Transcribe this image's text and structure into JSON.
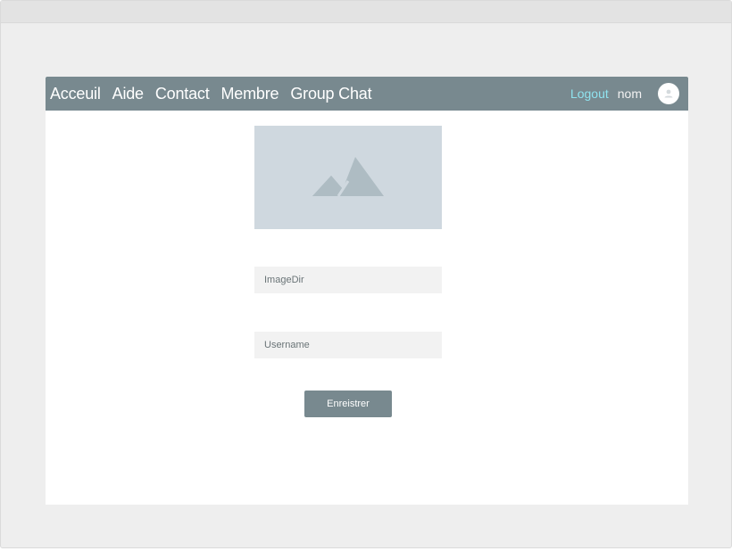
{
  "nav": {
    "links": [
      "Acceuil",
      "Aide",
      "Contact",
      "Membre",
      "Group Chat"
    ],
    "logout_label": "Logout",
    "user_name": "nom"
  },
  "form": {
    "image_dir_placeholder": "ImageDir",
    "username_placeholder": "Username",
    "save_label": "Enreistrer"
  },
  "icons": {
    "image_placeholder": "image-icon",
    "avatar": "user-icon"
  },
  "colors": {
    "navbar": "#78898f",
    "logout_link": "#8fe3ef",
    "image_placeholder_bg": "#cfd8df",
    "field_bg": "#f2f2f2",
    "button_bg": "#78898f"
  }
}
